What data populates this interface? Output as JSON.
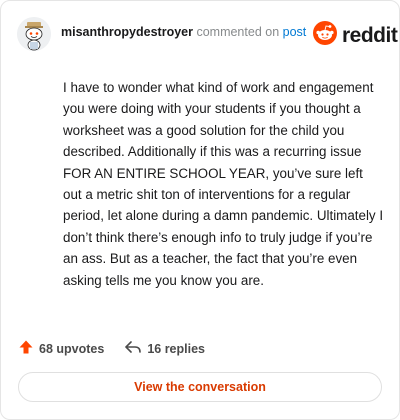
{
  "comment": {
    "author": "misanthropydestroyer",
    "action_text": " commented on ",
    "post_link": "post",
    "brand": "reddit",
    "body": "I have to wonder what kind of work and engagement you were doing with your students if you thought a worksheet was a good solution for the child you described. Additionally if this was a recurring issue FOR AN ENTIRE SCHOOL YEAR, you’ve sure left out a metric shit ton of interventions for a regular period, let alone during a damn pandemic. Ultimately I don’t think there’s enough info to truly judge if you’re an ass. But as a teacher, the fact that you’re even asking tells me you know you are."
  },
  "stats": {
    "upvotes": "68 upvotes",
    "replies": "16 replies"
  },
  "actions": {
    "view_conversation": "View the conversation"
  },
  "icons": {
    "avatar": "snoo-avatar-icon",
    "brand": "reddit-logo-icon",
    "upvote": "upvote-arrow-icon",
    "replies": "reply-arrow-icon"
  },
  "colors": {
    "brand_orange": "#ff4500",
    "link_blue": "#0079d3",
    "cta_orange": "#d93a00"
  }
}
